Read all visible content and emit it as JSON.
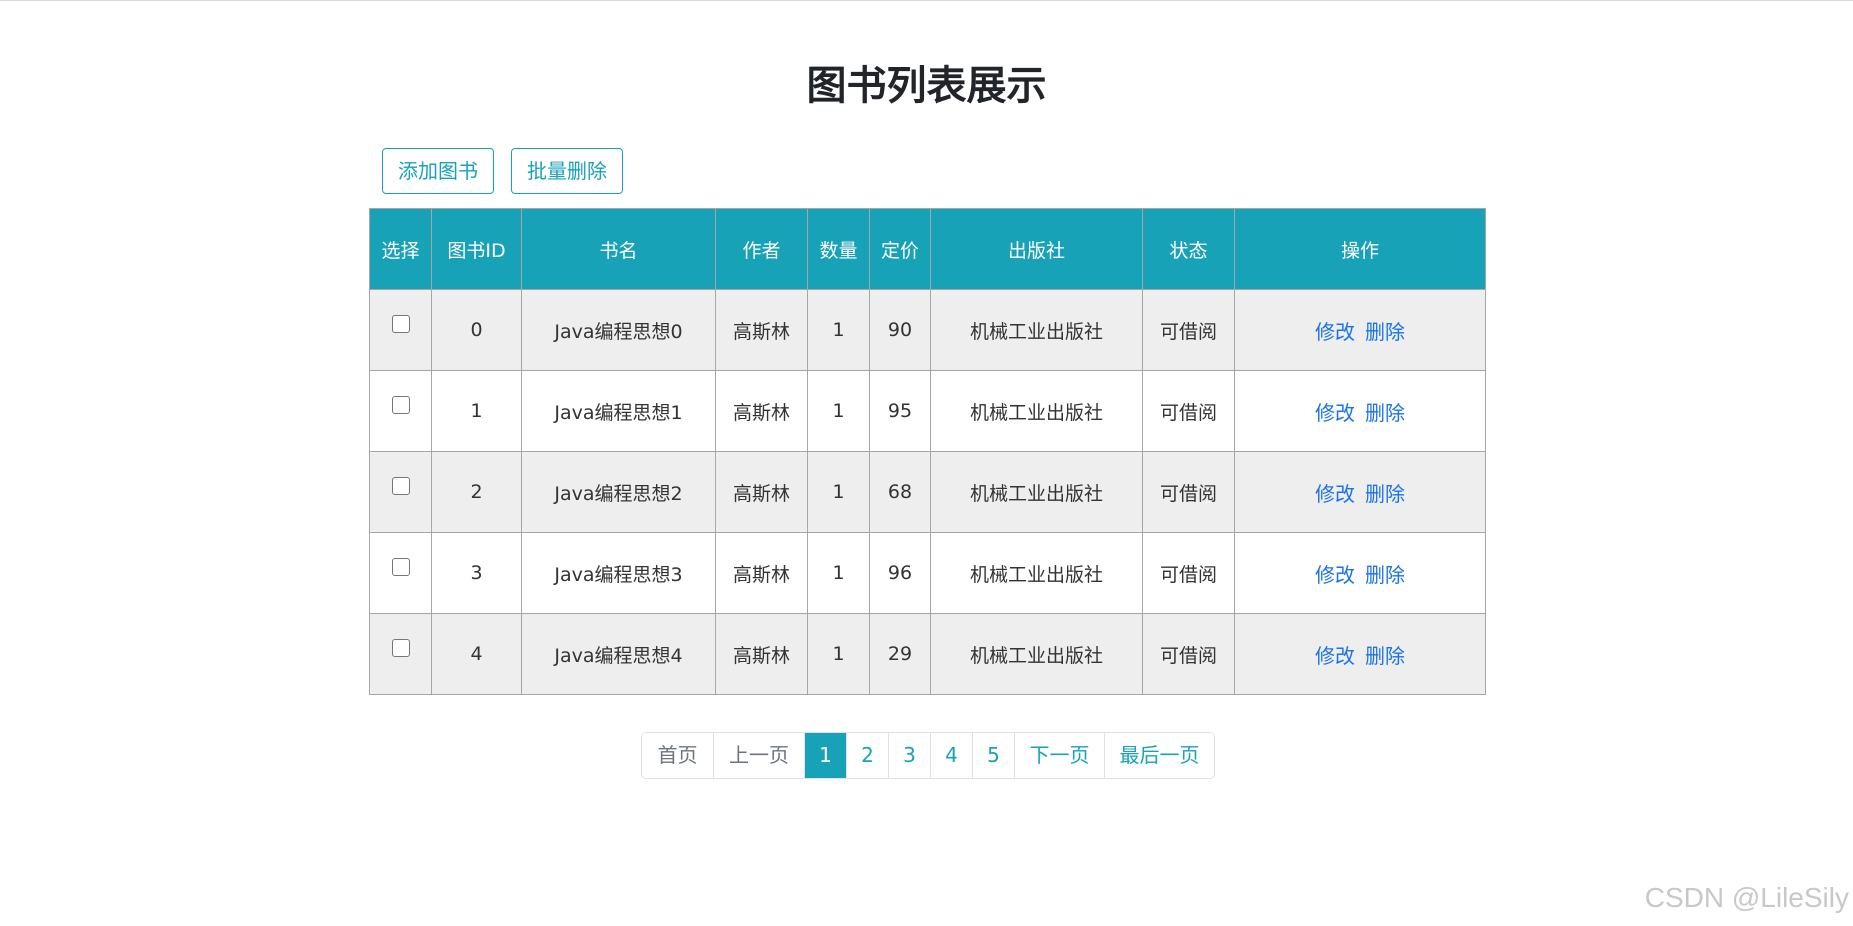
{
  "page": {
    "title": "图书列表展示"
  },
  "toolbar": {
    "add_label": "添加图书",
    "batch_delete_label": "批量删除"
  },
  "table": {
    "headers": [
      "选择",
      "图书ID",
      "书名",
      "作者",
      "数量",
      "定价",
      "出版社",
      "状态",
      "操作"
    ],
    "rows": [
      {
        "id": "0",
        "name": "Java编程思想0",
        "author": "高斯林",
        "count": "1",
        "price": "90",
        "publisher": "机械工业出版社",
        "status": "可借阅"
      },
      {
        "id": "1",
        "name": "Java编程思想1",
        "author": "高斯林",
        "count": "1",
        "price": "95",
        "publisher": "机械工业出版社",
        "status": "可借阅"
      },
      {
        "id": "2",
        "name": "Java编程思想2",
        "author": "高斯林",
        "count": "1",
        "price": "68",
        "publisher": "机械工业出版社",
        "status": "可借阅"
      },
      {
        "id": "3",
        "name": "Java编程思想3",
        "author": "高斯林",
        "count": "1",
        "price": "96",
        "publisher": "机械工业出版社",
        "status": "可借阅"
      },
      {
        "id": "4",
        "name": "Java编程思想4",
        "author": "高斯林",
        "count": "1",
        "price": "29",
        "publisher": "机械工业出版社",
        "status": "可借阅"
      }
    ],
    "edit_label": "修改",
    "delete_label": "删除"
  },
  "pagination": {
    "first": "首页",
    "prev": "上一页",
    "pages": [
      "1",
      "2",
      "3",
      "4",
      "5"
    ],
    "current": "1",
    "next": "下一页",
    "last": "最后一页"
  },
  "watermark": "CSDN @LileSily",
  "colors": {
    "accent": "#17a2b8",
    "link": "#1a73e8",
    "row_alt": "#eeeeee"
  }
}
